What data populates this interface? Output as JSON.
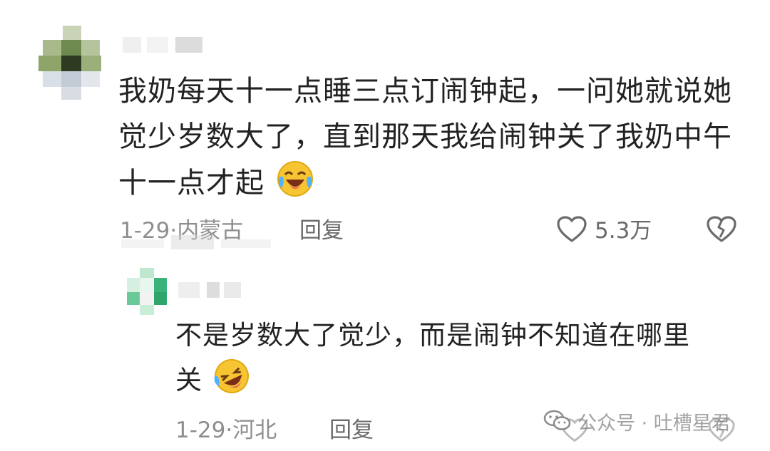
{
  "comment": {
    "text_line1": "我奶每天十一点睡三点订闹钟起，一问她就说她",
    "text_line2": "觉少岁数大了，直到那天我给闹钟关了我奶中午",
    "text_line3": "十一点才起",
    "emoji_icon": "crying-laughing-emoji-icon",
    "date_location": "1-29·内蒙古",
    "reply_label": "回复",
    "like_count": "5.3万"
  },
  "reply": {
    "text_line1": "不是岁数大了觉少，而是闹钟不知道在哪里",
    "text_line2": "关",
    "emoji_icon": "rolling-laughing-emoji-icon",
    "date_location": "1-29·河北",
    "reply_label": "回复"
  },
  "watermark": {
    "text": "公众号 · 吐槽星君",
    "icon": "wechat-icon"
  },
  "colors": {
    "text": "#222222",
    "meta": "#8e8e8e",
    "accent_green": "#3bb27a",
    "emoji_yellow": "#f7c531"
  }
}
